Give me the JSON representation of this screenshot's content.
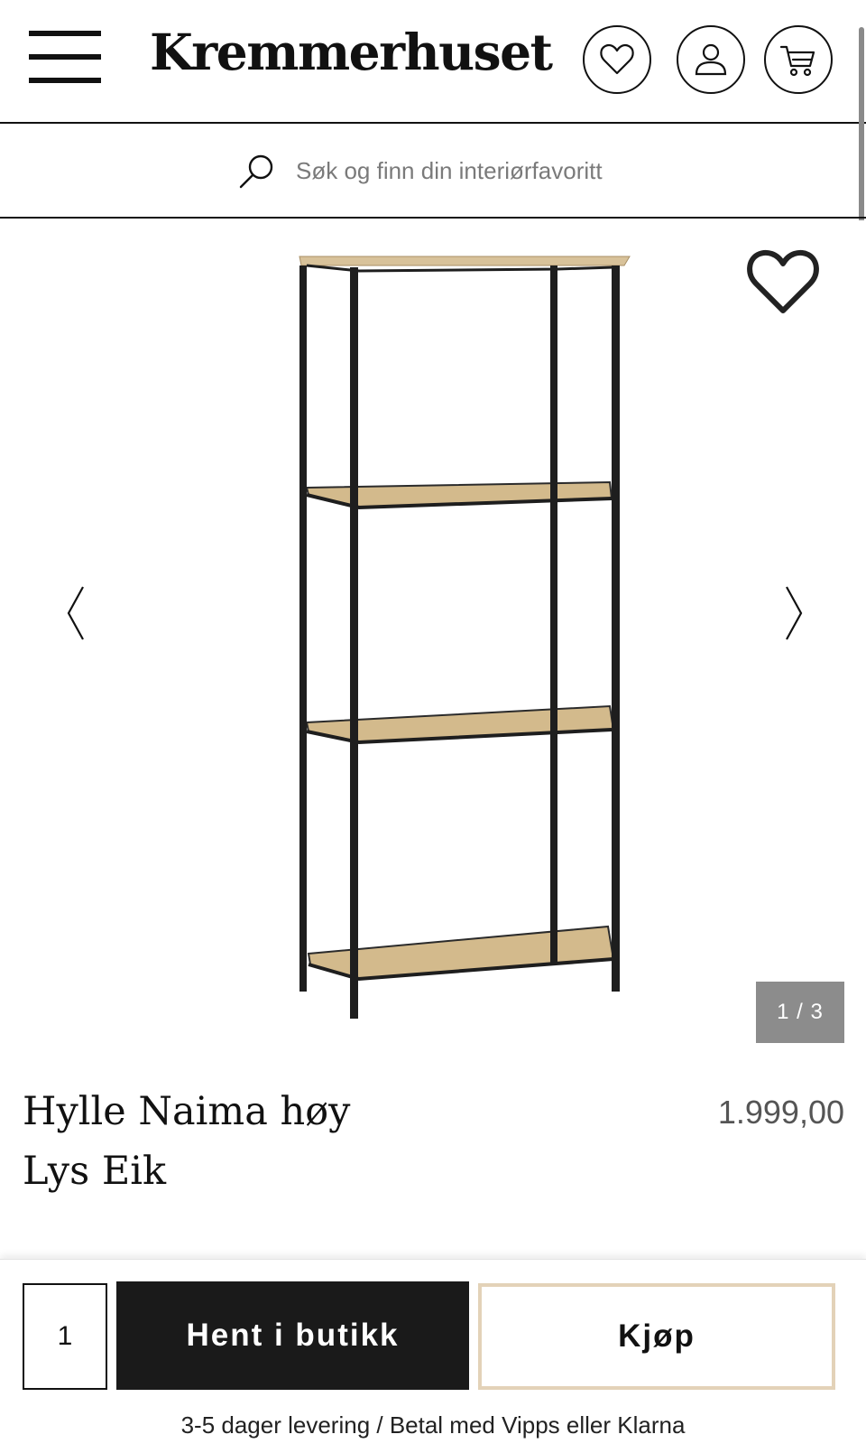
{
  "header": {
    "logo": "Kremmerhuset",
    "icons": [
      "menu-icon",
      "heart-icon",
      "user-icon",
      "cart-icon"
    ]
  },
  "search": {
    "placeholder": "Søk og finn din interiørfavoritt"
  },
  "gallery": {
    "counter": "1 / 3",
    "current_image": 1,
    "total_images": 3
  },
  "product": {
    "title_line1": "Hylle Naima høy",
    "title_line2": "Lys Eik",
    "price": "1.999,00"
  },
  "actions": {
    "quantity": "1",
    "pickup_label": "Hent i butikk",
    "buy_label": "Kjøp",
    "delivery_info": "3-5 dager levering / Betal med Vipps eller Klarna"
  },
  "colors": {
    "primary": "#1a1a1a",
    "buy_border": "#e3d2b8",
    "counter_bg": "#8c8c8c"
  }
}
